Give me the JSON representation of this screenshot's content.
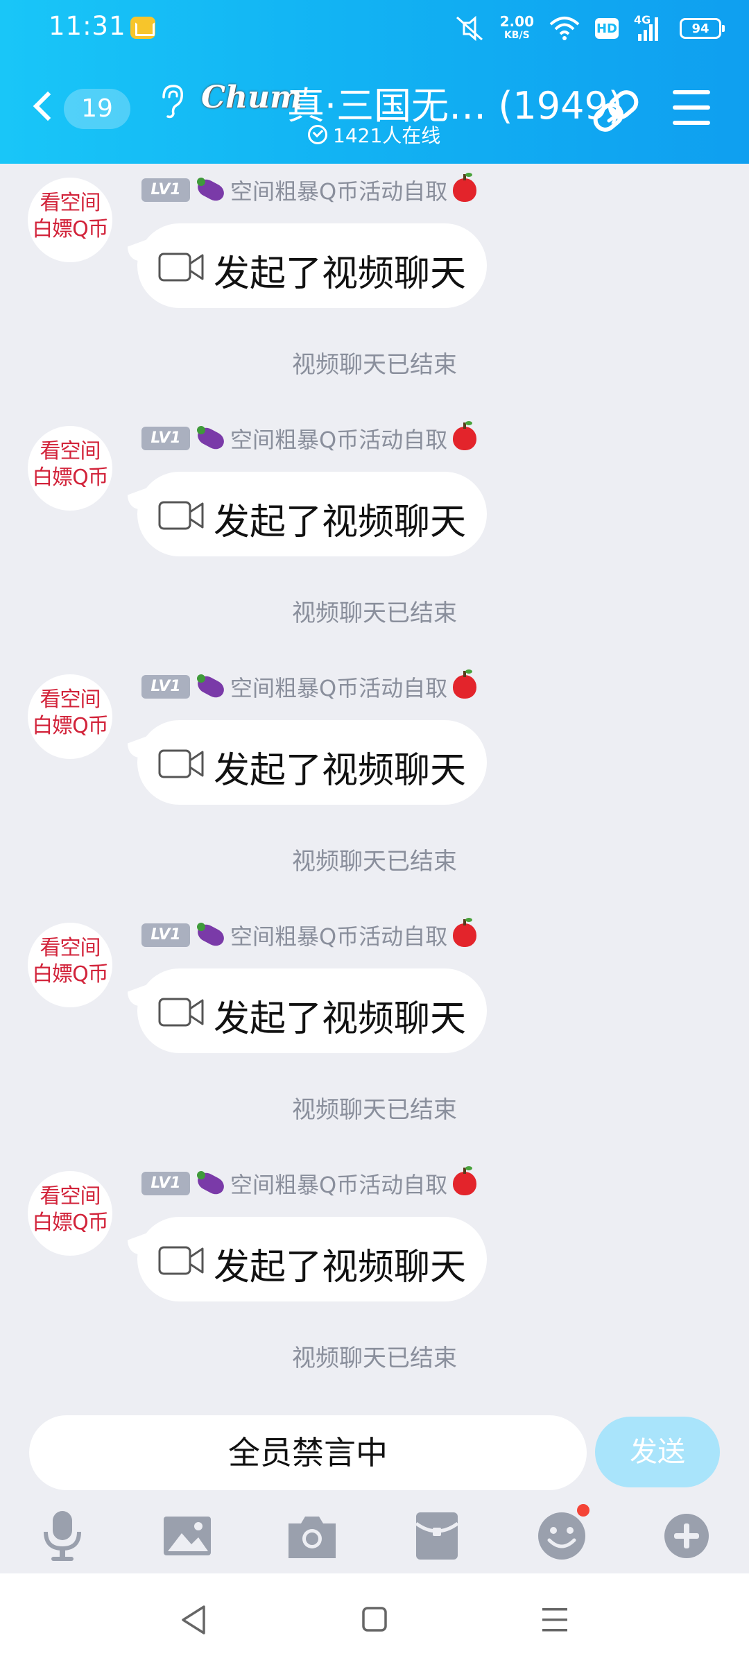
{
  "status_bar": {
    "time": "11:31",
    "net_speed_value": "2.00",
    "net_speed_unit": "KB/S",
    "hd_label": "HD",
    "network_type": "4G",
    "battery_level": "94",
    "icons": [
      "message-notification-icon",
      "mute-icon",
      "wifi-icon",
      "signal-icon",
      "battery-icon"
    ]
  },
  "header": {
    "unread_count": "19",
    "group_name": "真·三国无…",
    "member_count": "(1949)",
    "online_text": "1421人在线",
    "logo_text": "Chum"
  },
  "messages": [
    {
      "avatar_line1": "看空间",
      "avatar_line2": "白嫖Q币",
      "level": "LV1",
      "sender": "空间粗暴Q币活动自取",
      "content": "发起了视频聊天",
      "system_notice": "视频聊天已结束"
    },
    {
      "avatar_line1": "看空间",
      "avatar_line2": "白嫖Q币",
      "level": "LV1",
      "sender": "空间粗暴Q币活动自取",
      "content": "发起了视频聊天",
      "system_notice": "视频聊天已结束"
    },
    {
      "avatar_line1": "看空间",
      "avatar_line2": "白嫖Q币",
      "level": "LV1",
      "sender": "空间粗暴Q币活动自取",
      "content": "发起了视频聊天",
      "system_notice": "视频聊天已结束"
    },
    {
      "avatar_line1": "看空间",
      "avatar_line2": "白嫖Q币",
      "level": "LV1",
      "sender": "空间粗暴Q币活动自取",
      "content": "发起了视频聊天",
      "system_notice": "视频聊天已结束"
    },
    {
      "avatar_line1": "看空间",
      "avatar_line2": "白嫖Q币",
      "level": "LV1",
      "sender": "空间粗暴Q币活动自取",
      "content": "发起了视频聊天",
      "system_notice": "视频聊天已结束"
    }
  ],
  "input": {
    "muted_text": "全员禁言中",
    "send_label": "发送"
  },
  "toolbar": {
    "items": [
      "microphone-icon",
      "image-icon",
      "camera-icon",
      "red-packet-icon",
      "emoji-icon",
      "plus-icon"
    ]
  },
  "colors": {
    "header_gradient_start": "#19c6f8",
    "header_gradient_end": "#0f9ff0",
    "background": "#edeef3",
    "system_text": "#8a8f9c",
    "send_button": "#a9e4fb",
    "avatar_text": "#d2233a"
  }
}
